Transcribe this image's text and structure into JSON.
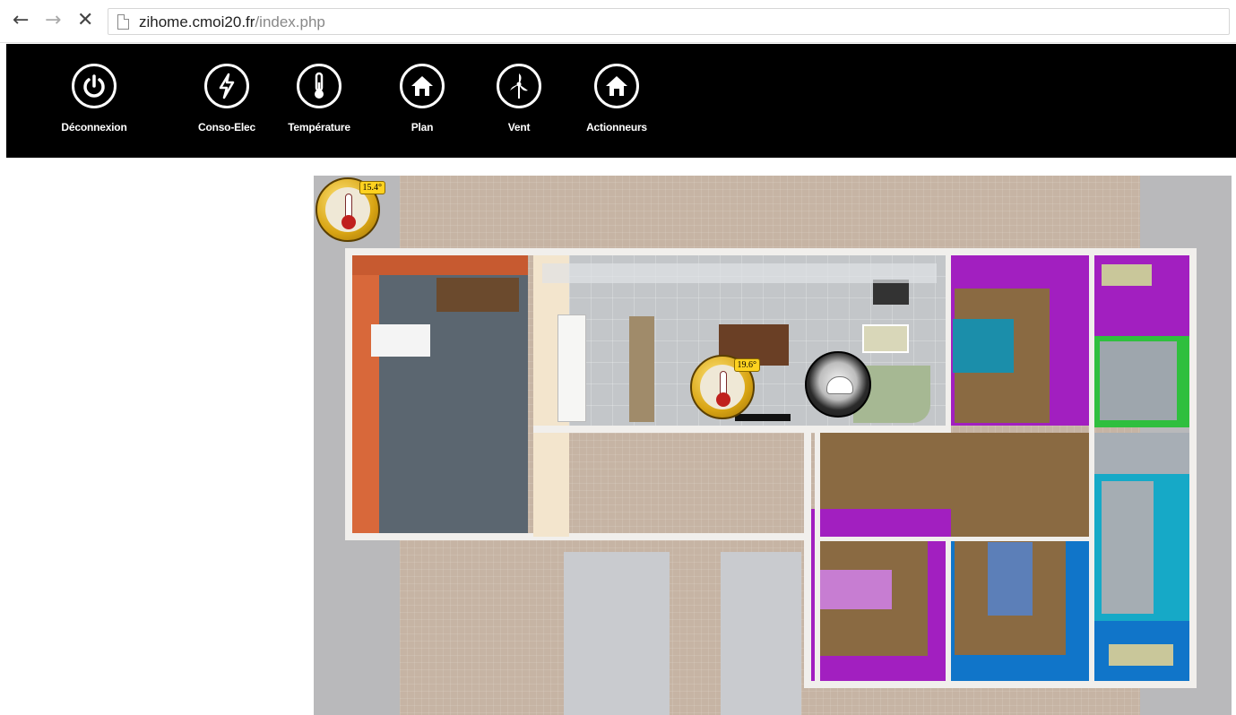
{
  "browser": {
    "url_host": "zihome.cmoi20.fr",
    "url_path": "/index.php",
    "icons": {
      "back": "back-arrow-icon",
      "forward": "forward-arrow-icon",
      "stop": "stop-icon",
      "page": "page-icon"
    }
  },
  "menu": {
    "items": [
      {
        "label": "Déconnexion",
        "icon": "power-icon"
      },
      {
        "label": "Conso-Elec",
        "icon": "lightning-icon"
      },
      {
        "label": "Température",
        "icon": "thermometer-icon"
      },
      {
        "label": "Plan",
        "icon": "home-icon"
      },
      {
        "label": "Vent",
        "icon": "wind-turbine-icon"
      },
      {
        "label": "Actionneurs",
        "icon": "home-icon"
      }
    ]
  },
  "plan": {
    "sensors": [
      {
        "value": "15.4°",
        "icon": "thermometer-icon"
      },
      {
        "value": "19.6°",
        "icon": "thermometer-icon"
      }
    ],
    "camera": {
      "icon": "camera-icon"
    },
    "colors": {
      "garage_wall": "#d8683a",
      "living_floor": "#c3c6c9",
      "purple_room": "#a21fc0",
      "green_room": "#2fbf3e",
      "blue_room": "#1389c8",
      "corridor_floor": "#8a6a42"
    }
  }
}
